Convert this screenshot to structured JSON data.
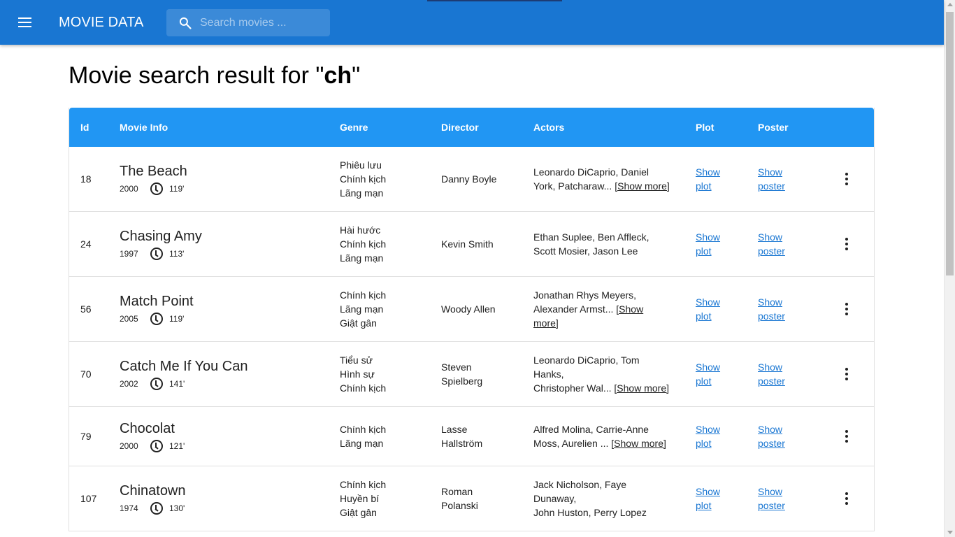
{
  "app": {
    "title": "MOVIE DATA",
    "menu_icon": "menu-icon",
    "search_icon": "search-icon",
    "search_placeholder": "Search movies ...",
    "colors": {
      "appbar": "#1976d2",
      "table_header": "#2196f3",
      "link": "#1976d2"
    }
  },
  "heading": {
    "prefix": "Movie search result for \"",
    "query": "ch",
    "suffix": "\""
  },
  "table": {
    "columns": {
      "id": "Id",
      "info": "Movie Info",
      "genre": "Genre",
      "director": "Director",
      "actors": "Actors",
      "plot": "Plot",
      "poster": "Poster"
    },
    "rows": [
      {
        "id": "18",
        "title": "The Beach",
        "year": "2000",
        "runtime": "119'",
        "genres": [
          "Phiêu lưu",
          "Chính kịch",
          "Lãng mạn"
        ],
        "director": [
          "Danny Boyle"
        ],
        "actors_lines": [
          "Leonardo DiCaprio, Daniel",
          "York, Patcharaw..."
        ],
        "show_more_line": 1,
        "show_more_inline": true,
        "show_more": "[Show more]",
        "plot_link": [
          "Show",
          "plot"
        ],
        "poster_link": [
          "Show",
          "poster"
        ]
      },
      {
        "id": "24",
        "title": "Chasing Amy",
        "year": "1997",
        "runtime": "113'",
        "genres": [
          "Hài hước",
          "Chính kịch",
          "Lãng mạn"
        ],
        "director": [
          "Kevin Smith"
        ],
        "actors_lines": [
          "Ethan Suplee, Ben Affleck,",
          "Scott Mosier, Jason Lee"
        ],
        "show_more_line": -1,
        "show_more": "",
        "plot_link": [
          "Show",
          "plot"
        ],
        "poster_link": [
          "Show",
          "poster"
        ]
      },
      {
        "id": "56",
        "title": "Match Point",
        "year": "2005",
        "runtime": "119'",
        "genres": [
          "Chính kịch",
          "Lãng mạn",
          "Giật gân"
        ],
        "director": [
          "Woody Allen"
        ],
        "actors_lines": [
          "Jonathan Rhys Meyers,",
          "Alexander Armst..."
        ],
        "show_more_line": 1,
        "show_more": "[Show more]",
        "show_more_split": [
          "[Show",
          "more]"
        ],
        "plot_link": [
          "Show",
          "plot"
        ],
        "poster_link": [
          "Show",
          "poster"
        ]
      },
      {
        "id": "70",
        "title": "Catch Me If You Can",
        "year": "2002",
        "runtime": "141'",
        "genres": [
          "Tiểu sử",
          "Hình sự",
          "Chính kịch"
        ],
        "director": [
          "Steven",
          "Spielberg"
        ],
        "actors_lines": [
          "Leonardo DiCaprio, Tom",
          "Hanks,",
          "Christopher Wal..."
        ],
        "show_more_line": 2,
        "show_more": "[Show more]",
        "plot_link": [
          "Show",
          "plot"
        ],
        "poster_link": [
          "Show",
          "poster"
        ]
      },
      {
        "id": "79",
        "title": "Chocolat",
        "year": "2000",
        "runtime": "121'",
        "genres": [
          "Chính kịch",
          "Lãng mạn"
        ],
        "director": [
          "Lasse",
          "Hallström"
        ],
        "actors_lines": [
          "Alfred Molina, Carrie-Anne",
          "Moss, Aurelien ..."
        ],
        "show_more_line": 1,
        "show_more": "[Show more]",
        "plot_link": [
          "Show",
          "plot"
        ],
        "poster_link": [
          "Show",
          "poster"
        ]
      },
      {
        "id": "107",
        "title": "Chinatown",
        "year": "1974",
        "runtime": "130'",
        "genres": [
          "Chính kịch",
          "Huyền bí",
          "Giật gân"
        ],
        "director": [
          "Roman",
          "Polanski"
        ],
        "actors_lines": [
          "Jack Nicholson, Faye",
          "Dunaway,",
          "John Huston, Perry Lopez"
        ],
        "show_more_line": -1,
        "show_more": "",
        "plot_link": [
          "Show",
          "plot"
        ],
        "poster_link": [
          "Show",
          "poster"
        ]
      }
    ]
  }
}
